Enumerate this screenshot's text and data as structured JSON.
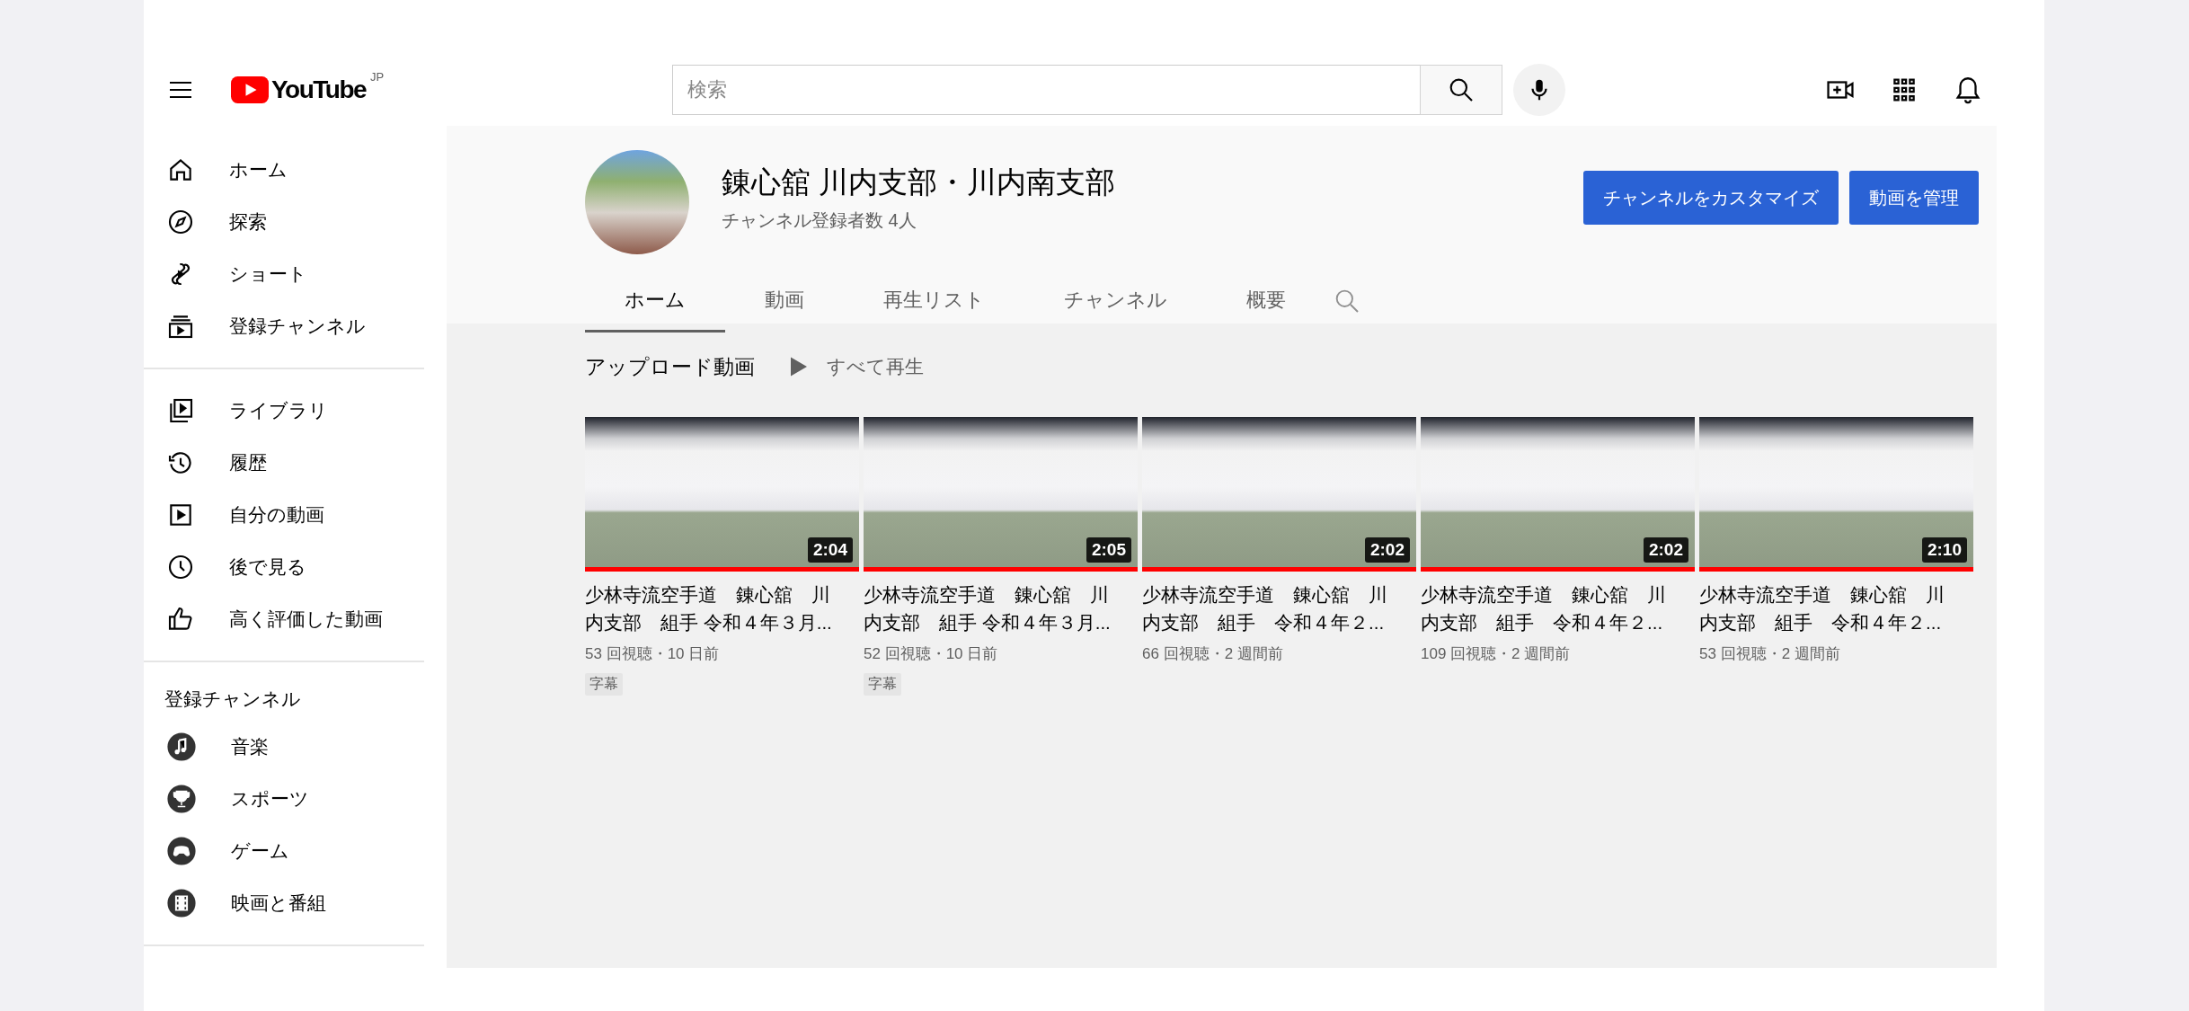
{
  "header": {
    "logo": "YouTube",
    "region": "JP",
    "search": {
      "placeholder": "検索"
    }
  },
  "sidebar": {
    "sections": [
      {
        "items": [
          {
            "kind": "home",
            "label": "ホーム"
          },
          {
            "kind": "explore",
            "label": "探索"
          },
          {
            "kind": "shorts",
            "label": "ショート"
          },
          {
            "kind": "subscriptions",
            "label": "登録チャンネル"
          }
        ]
      },
      {
        "items": [
          {
            "kind": "library",
            "label": "ライブラリ"
          },
          {
            "kind": "history",
            "label": "履歴"
          },
          {
            "kind": "myvideos",
            "label": "自分の動画"
          },
          {
            "kind": "watchlater",
            "label": "後で見る"
          },
          {
            "kind": "liked",
            "label": "高く評価した動画"
          }
        ]
      }
    ],
    "subscriptions": {
      "title": "登録チャンネル",
      "items": [
        {
          "kind": "music",
          "label": "音楽"
        },
        {
          "kind": "sports",
          "label": "スポーツ"
        },
        {
          "kind": "gaming",
          "label": "ゲーム"
        },
        {
          "kind": "movies",
          "label": "映画と番組"
        }
      ]
    }
  },
  "channel": {
    "name": "錬心舘 川内支部・川内南支部",
    "subscribers": "チャンネル登録者数 4人",
    "buttons": [
      "チャンネルをカスタマイズ",
      "動画を管理"
    ],
    "tabs": [
      {
        "label": "ホーム",
        "selected": true
      },
      {
        "label": "動画",
        "selected": false
      },
      {
        "label": "再生リスト",
        "selected": false
      },
      {
        "label": "チャンネル",
        "selected": false
      },
      {
        "label": "概要",
        "selected": false
      }
    ]
  },
  "shelf": {
    "title": "アップロード動画",
    "play_all": "すべて再生",
    "videos": [
      {
        "title": "少林寺流空手道　錬心舘　川内支部　組手 令和４年３月...",
        "duration": "2:04",
        "meta": "53 回視聴・10 日前",
        "badge": "字幕",
        "progress": {
          "level": 1
        }
      },
      {
        "title": "少林寺流空手道　錬心舘　川内支部　組手 令和４年３月...",
        "duration": "2:05",
        "meta": "52 回視聴・10 日前",
        "badge": "字幕",
        "progress": {
          "level": 1
        }
      },
      {
        "title": "少林寺流空手道　錬心舘　川内支部　組手　令和４年２...",
        "duration": "2:02",
        "meta": "66 回視聴・2 週間前",
        "progress": {
          "level": 1
        }
      },
      {
        "title": "少林寺流空手道　錬心舘　川内支部　組手　令和４年２...",
        "duration": "2:02",
        "meta": "109 回視聴・2 週間前",
        "progress": {
          "level": 1
        }
      },
      {
        "title": "少林寺流空手道　錬心舘　川内支部　組手　令和４年２...",
        "duration": "2:10",
        "meta": "53 回視聴・2 週間前",
        "progress": {
          "level": 1
        }
      }
    ]
  }
}
